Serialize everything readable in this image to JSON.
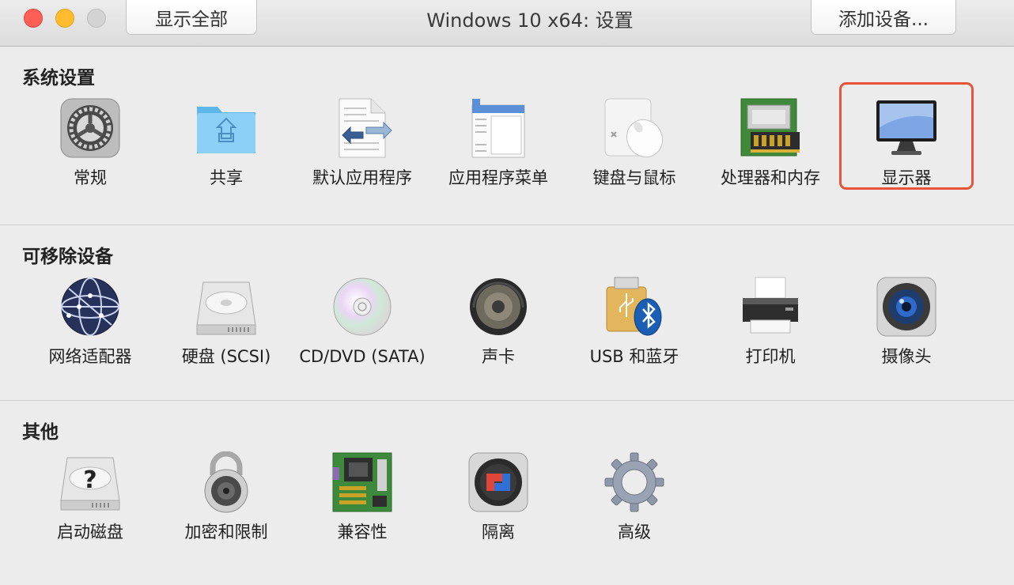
{
  "titlebar": {
    "title": "Windows 10 x64: 设置",
    "show_all_label": "显示全部",
    "add_device_label": "添加设备..."
  },
  "sections": [
    {
      "title": "系统设置",
      "items": [
        {
          "label": "常规",
          "icon": "general-icon"
        },
        {
          "label": "共享",
          "icon": "shared-folder-icon"
        },
        {
          "label": "默认应用程序",
          "icon": "default-apps-icon"
        },
        {
          "label": "应用程序菜单",
          "icon": "app-menu-icon"
        },
        {
          "label": "键盘与鼠标",
          "icon": "keyboard-mouse-icon"
        },
        {
          "label": "处理器和内存",
          "icon": "cpu-memory-icon"
        },
        {
          "label": "显示器",
          "icon": "display-icon",
          "highlighted": true
        }
      ]
    },
    {
      "title": "可移除设备",
      "items": [
        {
          "label": "网络适配器",
          "icon": "network-globe-icon"
        },
        {
          "label": "硬盘 (SCSI)",
          "icon": "hard-disk-icon"
        },
        {
          "label": "CD/DVD (SATA)",
          "icon": "cd-dvd-icon"
        },
        {
          "label": "声卡",
          "icon": "speaker-icon"
        },
        {
          "label": "USB 和蓝牙",
          "icon": "usb-bluetooth-icon"
        },
        {
          "label": "打印机",
          "icon": "printer-icon"
        },
        {
          "label": "摄像头",
          "icon": "camera-icon"
        }
      ]
    },
    {
      "title": "其他",
      "items": [
        {
          "label": "启动磁盘",
          "icon": "startup-disk-icon"
        },
        {
          "label": "加密和限制",
          "icon": "padlock-icon"
        },
        {
          "label": "兼容性",
          "icon": "motherboard-icon"
        },
        {
          "label": "隔离",
          "icon": "isolation-icon"
        },
        {
          "label": "高级",
          "icon": "advanced-gear-icon"
        }
      ]
    }
  ],
  "colors": {
    "highlight_border": "#e8543a",
    "window_background": "#ececec"
  }
}
